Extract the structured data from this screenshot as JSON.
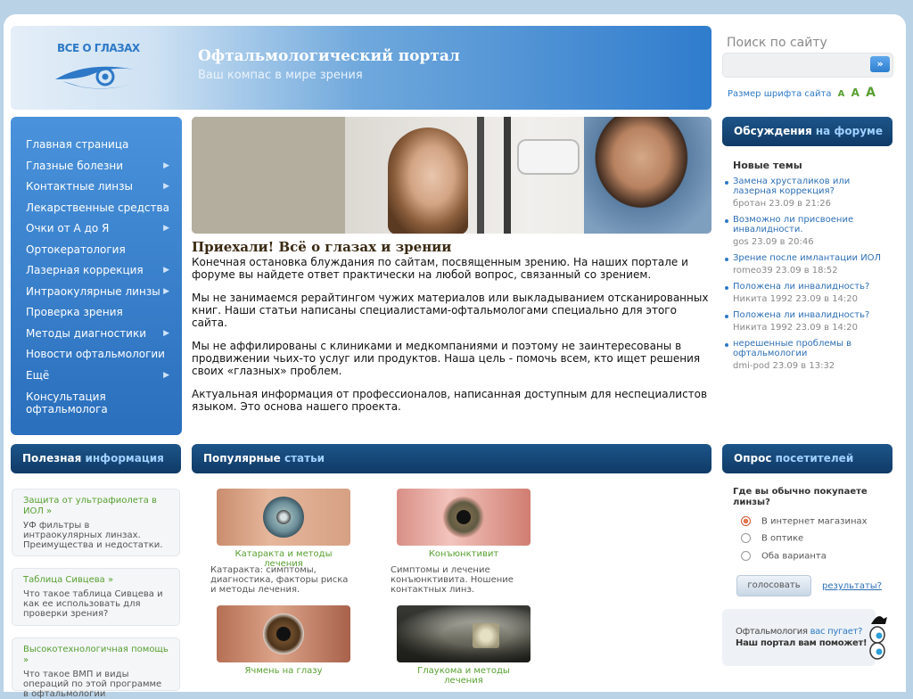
{
  "brand": {
    "logo_text": "ВСЕ О ГЛАЗАХ",
    "title": "Офтальмологический портал",
    "subtitle": "Ваш компас в мире зрения"
  },
  "search": {
    "label": "Поиск по сайту",
    "value": "",
    "button": "»"
  },
  "font_size": {
    "label": "Размер шрифта сайта",
    "small": "A",
    "medium": "A",
    "large": "A"
  },
  "nav": {
    "items": [
      {
        "label": "Главная страница",
        "arrow": ""
      },
      {
        "label": "Глазные болезни",
        "arrow": "▶"
      },
      {
        "label": "Контактные линзы",
        "arrow": "▶"
      },
      {
        "label": "Лекарственные средства",
        "arrow": ""
      },
      {
        "label": "Очки от А до Я",
        "arrow": "▶"
      },
      {
        "label": "Ортокератология",
        "arrow": ""
      },
      {
        "label": "Лазерная коррекция",
        "arrow": "▶"
      },
      {
        "label": "Интраокулярные линзы",
        "arrow": "▶"
      },
      {
        "label": "Проверка зрения",
        "arrow": ""
      },
      {
        "label": "Методы диагностики",
        "arrow": "▶"
      },
      {
        "label": "Новости офтальмологии",
        "arrow": ""
      },
      {
        "label": "Ещё",
        "arrow": "▶"
      },
      {
        "label": "Консультация офтальмолога",
        "arrow": ""
      }
    ]
  },
  "article": {
    "title": "Приехали! Всё о глазах и зрении",
    "paragraphs": [
      "Конечная остановка блуждания по сайтам, посвященным зрению. На наших портале и форуме вы найдете ответ практически на любой вопрос, связанный со зрением.",
      "Мы не занимаемся рерайтингом чужих материалов или выкладыванием отсканированных книг. Наши статьи написаны специалистами-офтальмологами специально для этого сайта.",
      "Мы не аффилированы с клиниками и медкомпаниями и поэтому не заинтересованы в продвижении чьих-то услуг или продуктов. Наша цель - помочь всем, кто ищет решения своих «глазных» проблем.",
      "Актуальная информация от профессионалов, написанная доступным для неспециалистов языком. Это основа нашего проекта."
    ]
  },
  "forum": {
    "title_a": "Обсуждения",
    "title_b": "на форуме",
    "subtitle": "Новые темы",
    "topics": [
      {
        "title": "Замена хрусталиков или лазерная коррекция?",
        "meta": "бротан 23.09 в 21:26"
      },
      {
        "title": "Возможно ли присвоение инвалидности.",
        "meta": "gos 23.09 в 20:46"
      },
      {
        "title": "Зрение после имлантации ИОЛ",
        "meta": "romeo39 23.09 в 18:52"
      },
      {
        "title": "Положена ли инвалидность?",
        "meta": "Никита 1992 23.09 в 14:20"
      },
      {
        "title": "Положена ли инвалидность?",
        "meta": "Никита 1992 23.09 в 14:20"
      },
      {
        "title": "нерешенные проблемы в офтальмологии",
        "meta": "dmi-pod 23.09 в 13:32"
      }
    ]
  },
  "useful": {
    "title_a": "Полезная",
    "title_b": "информация",
    "cards": [
      {
        "link": "Защита от ультрафиолета в ИОЛ »",
        "text": "УФ фильтры в интраокулярных линзах. Преимущества и недостатки."
      },
      {
        "link": "Таблица Сивцева »",
        "text": "Что такое таблица Сивцева и как ее использовать для проверки зрения?"
      },
      {
        "link": "Высокотехнологичная помощь »",
        "text": "Что такое ВМП и виды операций по этой программе в офтальмологии"
      }
    ]
  },
  "popular": {
    "title_a": "Популярные",
    "title_b": "статьи",
    "items": [
      {
        "caption": "Катаракта и методы лечения",
        "desc": "Катаракта: симптомы, диагностика, факторы риска и методы лечения."
      },
      {
        "caption": "Конъюнктивит",
        "desc": "Симптомы и лечение конъюнктивита. Ношение контактных линз."
      },
      {
        "caption": "Ячмень на глазу",
        "desc": ""
      },
      {
        "caption": "Глаукома и методы лечения",
        "desc": ""
      }
    ]
  },
  "poll": {
    "title_a": "Опрос",
    "title_b": "посетителей",
    "question": "Где вы обычно покупаете линзы?",
    "options": [
      "В интернет магазинах",
      "В оптике",
      "Оба варианта"
    ],
    "selected": 0,
    "vote": "голосовать",
    "results": "результаты?"
  },
  "promo": {
    "line1_a": "Офтальмология",
    "line1_b": "вас пугает?",
    "line2": "Наш портал вам поможет!"
  }
}
